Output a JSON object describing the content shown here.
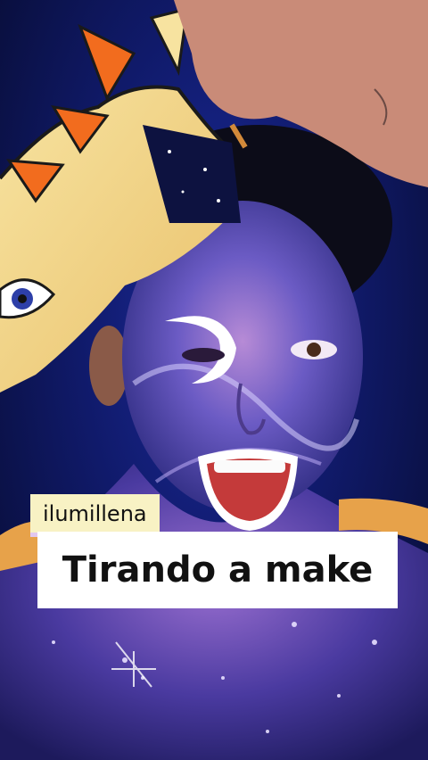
{
  "overlay": {
    "username": "ilumillena",
    "caption": "Tirando a make"
  },
  "colors": {
    "background": "#101a6a",
    "tag_background": "#f8f2c4",
    "tag_underline": "#e2c8f0",
    "caption_background": "#ffffff",
    "text": "#111111"
  }
}
